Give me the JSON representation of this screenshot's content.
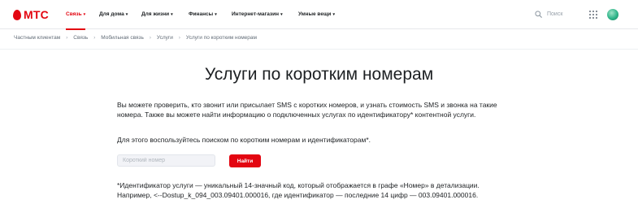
{
  "brand": {
    "logo_text": "МТС",
    "accent_color": "#e30611"
  },
  "nav": {
    "items": [
      {
        "label": "Связь",
        "active": true
      },
      {
        "label": "Для дома",
        "active": false
      },
      {
        "label": "Для жизни",
        "active": false
      },
      {
        "label": "Финансы",
        "active": false
      },
      {
        "label": "Интернет-магазин",
        "active": false
      },
      {
        "label": "Умные вещи",
        "active": false
      }
    ],
    "search_label": "Поиск"
  },
  "breadcrumbs": [
    "Частным клиентам",
    "Связь",
    "Мобильная связь",
    "Услуги",
    "Услуги по коротким номерам"
  ],
  "page": {
    "title": "Услуги по коротким номерам",
    "intro": "Вы можете проверить, кто звонит или присылает SMS с коротких номеров, и узнать стоимость SMS и звонка на такие номера. Также вы можете найти информацию о подключенных услугах по идентификатору* контентной услуги.",
    "instruction": "Для этого воспользуйтесь поиском по коротким номерам и идентификаторам*.",
    "search_input": {
      "value": "",
      "placeholder": "Короткий номер"
    },
    "find_button": "Найти",
    "footnote": "*Идентификатор услуги — уникальный 14-значный код, который отображается в графе «Номер» в детализации. Например, <--Dostup_k_094_003.09401.000016, где идентификатор — последние 14 цифр — 003.09401.000016."
  }
}
